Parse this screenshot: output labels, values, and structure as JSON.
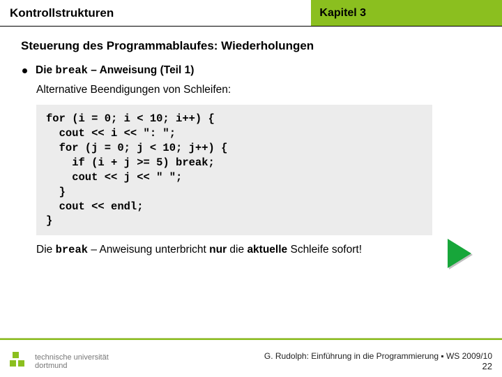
{
  "header": {
    "left": "Kontrollstrukturen",
    "right": "Kapitel 3"
  },
  "subtitle": "Steuerung des Programmablaufes: Wiederholungen",
  "bullet": {
    "pre": "Die ",
    "code": "break",
    "post": " – Anweisung (Teil 1)"
  },
  "alt": "Alternative Beendigungen von Schleifen:",
  "code": "for (i = 0; i < 10; i++) {\n  cout << i << \": \";\n  for (j = 0; j < 10; j++) {\n    if (i + j >= 5) break;\n    cout << j << \" \";\n  }\n  cout << endl;\n}",
  "caption": {
    "t1": "Die ",
    "code": "break",
    "t2": " – Anweisung unterbricht ",
    "b1": "nur",
    "t3": " die ",
    "b2": "aktuelle",
    "t4": " Schleife sofort!"
  },
  "logo": {
    "line1": "technische universität",
    "line2": "dortmund"
  },
  "footer": {
    "author": "G. Rudolph: Einführung in die Programmierung ▪ WS 2009/10",
    "page": "22"
  }
}
